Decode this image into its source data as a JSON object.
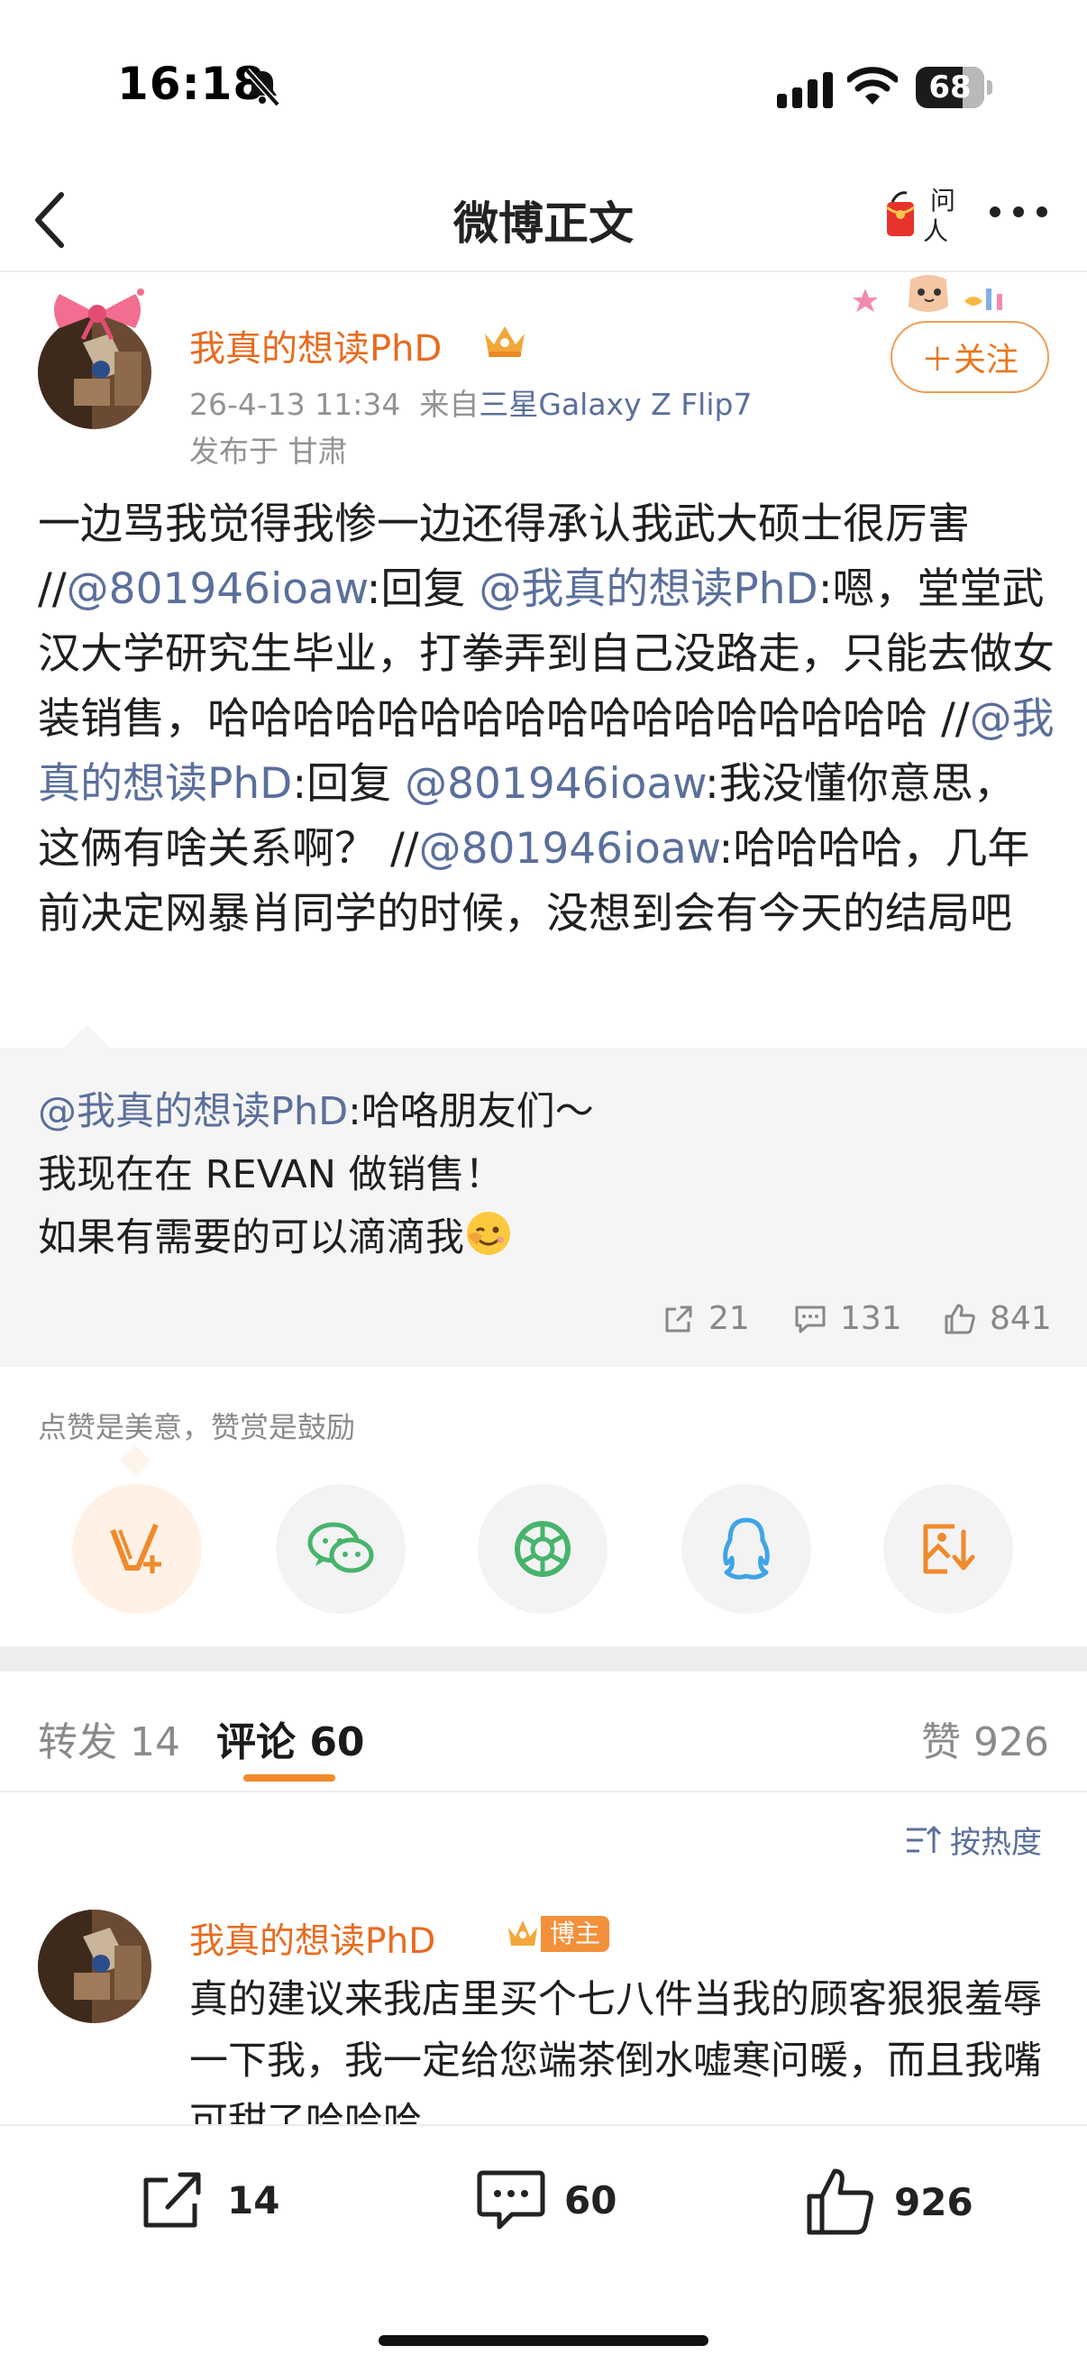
{
  "status_bar": {
    "time": "16:18",
    "battery": "68",
    "battery_level": 0.68
  },
  "nav": {
    "title": "微博正文",
    "ask_label_top": "问",
    "ask_label_bottom": "人"
  },
  "post": {
    "username": "我真的想读PhD",
    "date": "26-4-13 11:34",
    "source_prefix": "来自",
    "source_device": "三星Galaxy Z Flip7",
    "location": "发布于 甘肃",
    "follow_label": "＋关注",
    "text": [
      {
        "t": "一边骂我觉得我惨一边还得承认我武大硕士很厉害 //",
        "m": false
      },
      {
        "t": "@801946ioaw",
        "m": true
      },
      {
        "t": ":回复 ",
        "m": false
      },
      {
        "t": "@我真的想读PhD",
        "m": true
      },
      {
        "t": ":嗯，堂堂武汉大学研究生毕业，打拳弄到自己没路走，只能去做女装销售，哈哈哈哈哈哈哈哈哈哈哈哈哈哈哈哈哈 //",
        "m": false
      },
      {
        "t": "@我真的想读PhD",
        "m": true
      },
      {
        "t": ":回复 ",
        "m": false
      },
      {
        "t": "@801946ioaw",
        "m": true
      },
      {
        "t": ":我没懂你意思，这俩有啥关系啊？ //",
        "m": false
      },
      {
        "t": "@801946ioaw",
        "m": true
      },
      {
        "t": ":哈哈哈哈，几年前决定网暴肖同学的时候，没想到会有今天的结局吧",
        "m": false
      }
    ]
  },
  "repost": {
    "author": "@我真的想读PhD",
    "line1": ":哈咯朋友们～",
    "line2": "我现在在 REVAN 做销售！",
    "line3": "如果有需要的可以滴滴我",
    "emoji_icon": "wink-emoji",
    "reposts": "21",
    "comments": "131",
    "likes": "841"
  },
  "reward": {
    "caption": "点赞是美意，赞赏是鼓励",
    "buttons": [
      "v-plus-icon",
      "wechat-icon",
      "moments-icon",
      "qq-icon",
      "save-image-icon"
    ]
  },
  "tabs": {
    "repost": "转发 14",
    "comment": "评论 60",
    "like": "赞 926",
    "sort": "按热度"
  },
  "comment": {
    "username": "我真的想读PhD",
    "badge": "博主",
    "text": "真的建议来我店里买个七八件当我的顾客狠狠羞辱一下我，我一定给您端茶倒水嘘寒问暖，而且我嘴可甜了哈哈哈"
  },
  "bottom_bar": {
    "reposts": "14",
    "comments": "60",
    "likes": "926"
  },
  "colors": {
    "accent": "#e86b1f",
    "link": "#5b6f9b",
    "tab_indicator": "#f08a2c"
  }
}
